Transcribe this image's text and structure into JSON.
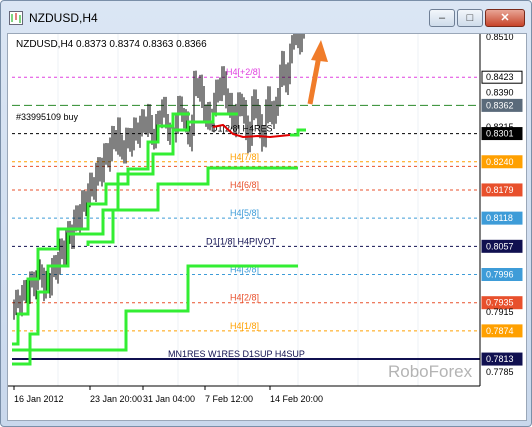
{
  "window": {
    "title": "NZDUSD,H4",
    "minimize_glyph": "–",
    "maximize_glyph": "□",
    "close_glyph": "✕"
  },
  "chart": {
    "header": "NZDUSD,H4  0.8373 0.8374 0.8363 0.8366",
    "order_label": "#33995109 buy",
    "watermark": "RoboForex",
    "arrow_color": "#f07c2a"
  },
  "chart_data": {
    "type": "candlestick",
    "symbol": "NZDUSD",
    "timeframe": "H4",
    "ohlc_last": {
      "open": 0.8373,
      "high": 0.8374,
      "low": 0.8363,
      "close": 0.8366
    },
    "y_ticks": [
      "0.8510",
      "0.8362",
      "0.8315",
      "0.8301",
      "0.8240",
      "0.8179",
      "0.8118",
      "0.8057",
      "0.7996",
      "0.7935",
      "0.7874",
      "0.7813",
      "0.7785",
      "0.8423"
    ],
    "price_axis": [
      {
        "label": "0.8510",
        "value": 0.851,
        "style": "plain"
      },
      {
        "label": "0.8423",
        "value": 0.8423,
        "style": "boxed",
        "color": "#ffffff",
        "text": "#000000"
      },
      {
        "label": "0.8390",
        "value": 0.839,
        "style": "plain"
      },
      {
        "label": "0.8362",
        "value": 0.8362,
        "style": "filled",
        "color": "#5a6a7a",
        "text": "#ffffff"
      },
      {
        "label": "0.8315",
        "value": 0.8315,
        "style": "plain"
      },
      {
        "label": "0.8301",
        "value": 0.8301,
        "style": "filled",
        "color": "#000000",
        "text": "#ffffff"
      },
      {
        "label": "0.8240",
        "value": 0.824,
        "style": "filled",
        "color": "#ffa000",
        "text": "#ffffff"
      },
      {
        "label": "0.8179",
        "value": 0.8179,
        "style": "filled",
        "color": "#e8502c",
        "text": "#ffffff"
      },
      {
        "label": "0.8118",
        "value": 0.8118,
        "style": "filled",
        "color": "#3e9cd8",
        "text": "#ffffff"
      },
      {
        "label": "0.8057",
        "value": 0.8057,
        "style": "filled",
        "color": "#101050",
        "text": "#ffffff"
      },
      {
        "label": "0.7996",
        "value": 0.7996,
        "style": "filled",
        "color": "#3e9cd8",
        "text": "#ffffff"
      },
      {
        "label": "0.7935",
        "value": 0.7935,
        "style": "filled",
        "color": "#e8502c",
        "text": "#ffffff"
      },
      {
        "label": "0.7915",
        "value": 0.7915,
        "style": "plain"
      },
      {
        "label": "0.7874",
        "value": 0.7874,
        "style": "filled",
        "color": "#ffa000",
        "text": "#ffffff"
      },
      {
        "label": "0.7813",
        "value": 0.7813,
        "style": "filled",
        "color": "#101050",
        "text": "#ffffff"
      },
      {
        "label": "0.7785",
        "value": 0.7785,
        "style": "plain"
      }
    ],
    "levels": [
      {
        "label": "H4[+2/8]",
        "value": 0.8423,
        "color": "#e040e0"
      },
      {
        "label": "D1[2/8] H4RES",
        "value": 0.8301,
        "color": "#000000"
      },
      {
        "label": "H4[7/8]",
        "value": 0.824,
        "color": "#ffa000"
      },
      {
        "label": "",
        "value": 0.823,
        "color": "#e8502c"
      },
      {
        "label": "H4[6/8]",
        "value": 0.8179,
        "color": "#e8502c"
      },
      {
        "label": "H4[5/8]",
        "value": 0.8118,
        "color": "#3e9cd8"
      },
      {
        "label": "D1[1/8] H4PIVOT",
        "value": 0.8057,
        "color": "#101050"
      },
      {
        "label": "H4[3/8]",
        "value": 0.7996,
        "color": "#3e9cd8"
      },
      {
        "label": "H4[2/8]",
        "value": 0.7935,
        "color": "#e8502c"
      },
      {
        "label": "H4[1/8]",
        "value": 0.7874,
        "color": "#ffa000"
      },
      {
        "label": "MN1RES W1RES D1SUP H4SUP",
        "value": 0.7813,
        "color": "#101050"
      }
    ],
    "order_price": 0.8362,
    "x_labels": [
      "16 Jan 2012",
      "23 Jan 20:00",
      "31 Jan 04:00",
      "7 Feb 12:00",
      "14 Feb 20:00"
    ],
    "ylim": [
      0.777,
      0.853
    ]
  }
}
